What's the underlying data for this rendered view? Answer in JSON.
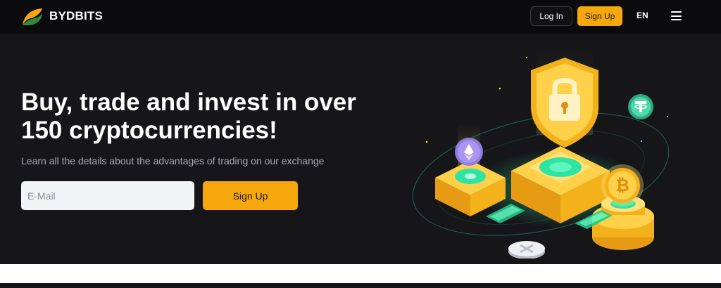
{
  "header": {
    "brand_name": "BYDBITS",
    "login_label": "Log In",
    "signup_label": "Sign Up",
    "language": "EN"
  },
  "hero": {
    "headline_line1": "Buy, trade and invest in over",
    "headline_line2": "150 cryptocurrencies!",
    "subtext": "Learn all the details about the advantages of trading on our exchange",
    "email_placeholder": "E-Mail",
    "signup_label": "Sign Up"
  },
  "colors": {
    "accent": "#f5a70c",
    "header_bg": "#0b0b0d",
    "hero_bg": "#161619",
    "logo_orange": "#f5a70c",
    "logo_green": "#2e8b3d"
  },
  "icons": [
    "logo-icon",
    "menu-icon",
    "lock-shield-icon",
    "ethereum-coin-icon",
    "tether-coin-icon",
    "bitcoin-coin-icon"
  ]
}
